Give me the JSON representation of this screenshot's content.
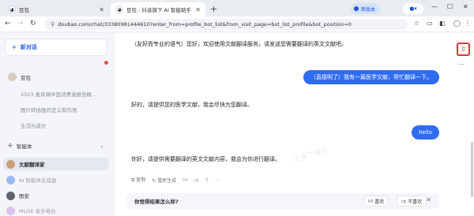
{
  "browser": {
    "tabs": [
      {
        "title": "豆包",
        "active": false
      },
      {
        "title": "豆包 - 抖音旗下 AI 智能助手",
        "active": true
      }
    ],
    "new_tab_icon": "plus-icon",
    "badge_label": "新版本",
    "url": "doubao.com/chat/33380981444610?enter_from=profile_bot_list&from_visit_page=bot_list_profile&bot_position=0",
    "accent": "#2f6bf3"
  },
  "sidebar": {
    "new_chat_label": "新对话",
    "doubao_label": "豆包",
    "history": [
      "2023 麦肯锡中国消费者报告概...",
      "图片转插画的定义和作用",
      "生活与成长"
    ],
    "agents_label": "智能体",
    "agents": [
      {
        "name": "文献翻译家",
        "active": true,
        "dim": false,
        "color": "#c8a27a"
      },
      {
        "name": "AI 智能体生成器",
        "active": false,
        "dim": true,
        "color": "#9bb7f5"
      },
      {
        "name": "图安",
        "active": false,
        "dim": false,
        "color": "#5c6470"
      },
      {
        "name": "MUSE 音乐电台",
        "active": false,
        "dim": true,
        "color": "#d9c6ef"
      }
    ]
  },
  "chat": {
    "messages": [
      {
        "role": "ai",
        "text": "（友好而专业的语气）您好，欢迎使用文献翻译服务，请发送您需要翻译的英文文献吧。"
      },
      {
        "role": "user",
        "text": "（直接明了）我有一篇医学文献，帮忙翻译一下。"
      },
      {
        "role": "ai",
        "text": "好的，请提供您的医学文献，我会尽快为您翻译。"
      },
      {
        "role": "user",
        "text": "hello"
      },
      {
        "role": "ai",
        "text": "你好，请提供需要翻译的英文文献内容，我会为你进行翻译。"
      }
    ],
    "actions": {
      "copy": "复制",
      "regenerate": "重新生成"
    },
    "feedback": {
      "question": "你觉得结果怎么样?",
      "like": "喜欢",
      "dislike": "不喜欢"
    },
    "watermark": "天真下载站"
  }
}
